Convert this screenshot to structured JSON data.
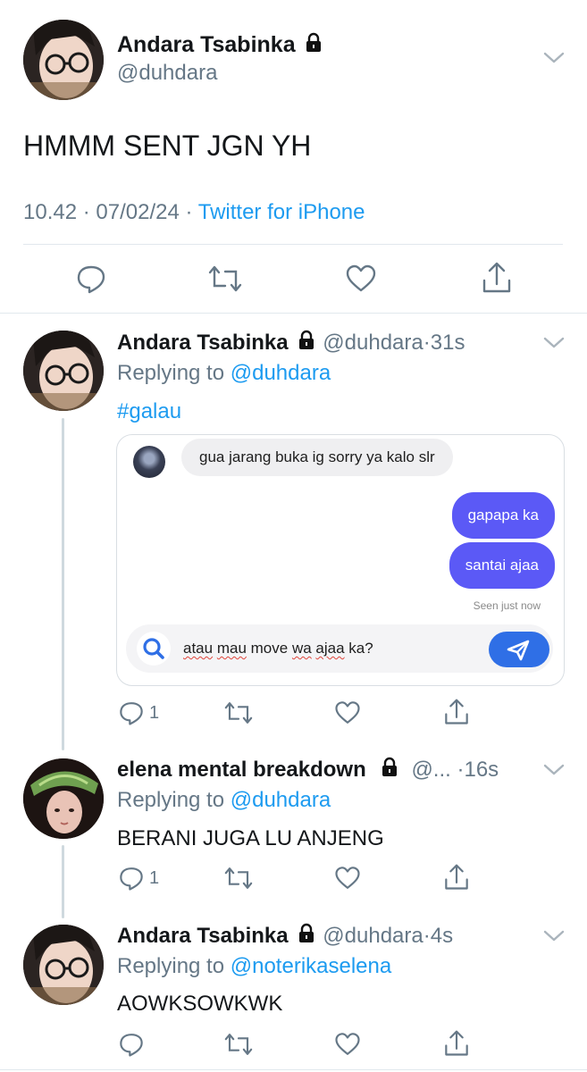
{
  "main_tweet": {
    "display_name": "Andara Tsabinka",
    "handle": "@duhdara",
    "text": "HMMM SENT JGN YH",
    "time": "10.42",
    "date": "07/02/24",
    "separator": "·",
    "client": "Twitter for iPhone"
  },
  "replies": [
    {
      "display_name": "Andara Tsabinka",
      "handle": "@duhdara",
      "age": "31s",
      "replying_prefix": "Replying to",
      "replying_to": "@duhdara",
      "text": "#galau",
      "reply_count": "1"
    },
    {
      "display_name": "elena mental breakdown",
      "handle": "@...",
      "age": "16s",
      "replying_prefix": "Replying to",
      "replying_to": "@duhdara",
      "text": "BERANI JUGA LU ANJENG",
      "reply_count": "1"
    },
    {
      "display_name": "Andara Tsabinka",
      "handle": "@duhdara",
      "age": "4s",
      "replying_prefix": "Replying to",
      "replying_to": "@noterikaselena",
      "text": "AOWKSOWKWK",
      "reply_count": ""
    }
  ],
  "dm_card": {
    "incoming": "gua jarang buka ig sorry ya kalo slr",
    "outgoing": [
      "gapapa ka",
      "santai ajaa"
    ],
    "seen": "Seen just now",
    "input_text_parts": [
      "atau",
      "mau",
      "move",
      "wa",
      "ajaa",
      "ka?"
    ]
  },
  "icons": {
    "lock": "lock-icon",
    "chevron": "chevron-down-icon",
    "reply": "reply-icon",
    "retweet": "retweet-icon",
    "like": "heart-icon",
    "share": "share-icon",
    "search": "search-icon",
    "send": "send-icon"
  },
  "colors": {
    "link": "#1d9bf0",
    "muted": "#657786",
    "dm_outgoing": "#5b59f6",
    "dm_send": "#2f6fe6"
  }
}
